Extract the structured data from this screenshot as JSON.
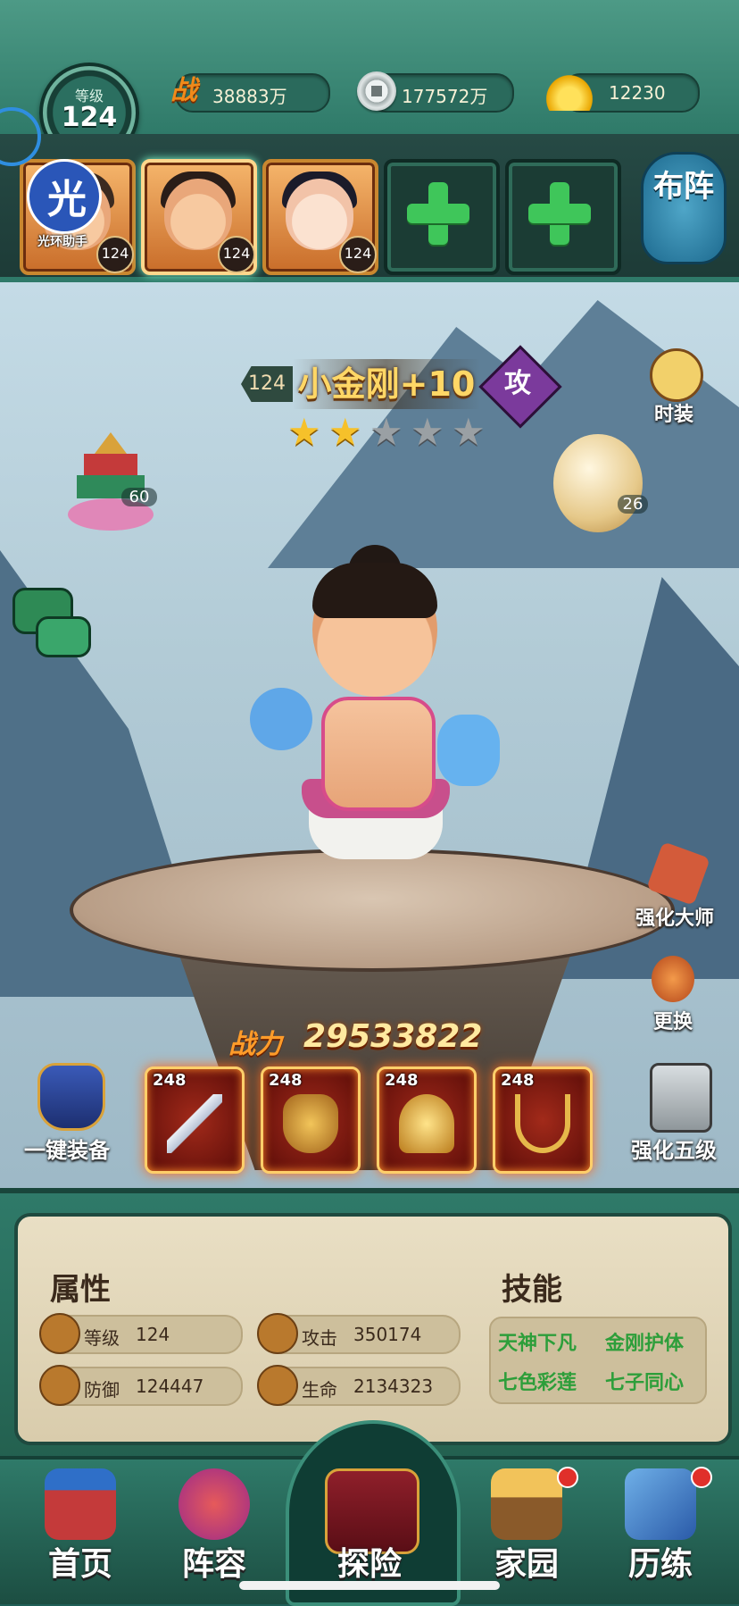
{
  "player": {
    "level_label": "等级",
    "level": "124"
  },
  "resources": {
    "power_icon": "战",
    "power_value": "38883万",
    "coin_value": "177572万",
    "gold_value": "12230"
  },
  "team": {
    "heroes": [
      {
        "level": "124",
        "active": false
      },
      {
        "level": "124",
        "active": true
      },
      {
        "level": "124",
        "active": false
      }
    ],
    "empty_slots": 2,
    "formation_label": "布阵"
  },
  "watermark": {
    "char": "光",
    "text": "光环助手"
  },
  "hero": {
    "level": "124",
    "name": "小金刚+10",
    "type": "攻",
    "stars_total": 5,
    "stars_filled": 2,
    "combat_power_label": "战力",
    "combat_power": "29533822"
  },
  "side_buttons": {
    "costume": "时装",
    "pagoda_count": "60",
    "egg_count": "26",
    "enhance_master": "强化大师",
    "replace": "更换"
  },
  "equipment": {
    "equip_all": "一键装备",
    "upgrade_five": "强化五级",
    "items": [
      {
        "level": "248",
        "icon": "sword-icon"
      },
      {
        "level": "248",
        "icon": "armor-icon"
      },
      {
        "level": "248",
        "icon": "helmet-icon"
      },
      {
        "level": "248",
        "icon": "necklace-icon"
      }
    ]
  },
  "attributes": {
    "title": "属性",
    "level_label": "等级",
    "level_value": "124",
    "attack_label": "攻击",
    "attack_value": "350174",
    "defense_label": "防御",
    "defense_value": "124447",
    "hp_label": "生命",
    "hp_value": "2134323"
  },
  "skills": {
    "title": "技能",
    "list": [
      "天神下凡",
      "金刚护体",
      "七色彩莲",
      "七子同心"
    ]
  },
  "nav": {
    "items": [
      {
        "label": "首页",
        "badge": false
      },
      {
        "label": "阵容",
        "badge": false
      },
      {
        "label": "探险",
        "badge": false
      },
      {
        "label": "家园",
        "badge": true
      },
      {
        "label": "历练",
        "badge": true
      }
    ]
  },
  "colors": {
    "frame_green": "#2f7a69",
    "gold_text": "#ffd766",
    "skill_green": "#2d9e3a",
    "star_on": "#f6c12a",
    "star_off": "#9aa0a4"
  }
}
